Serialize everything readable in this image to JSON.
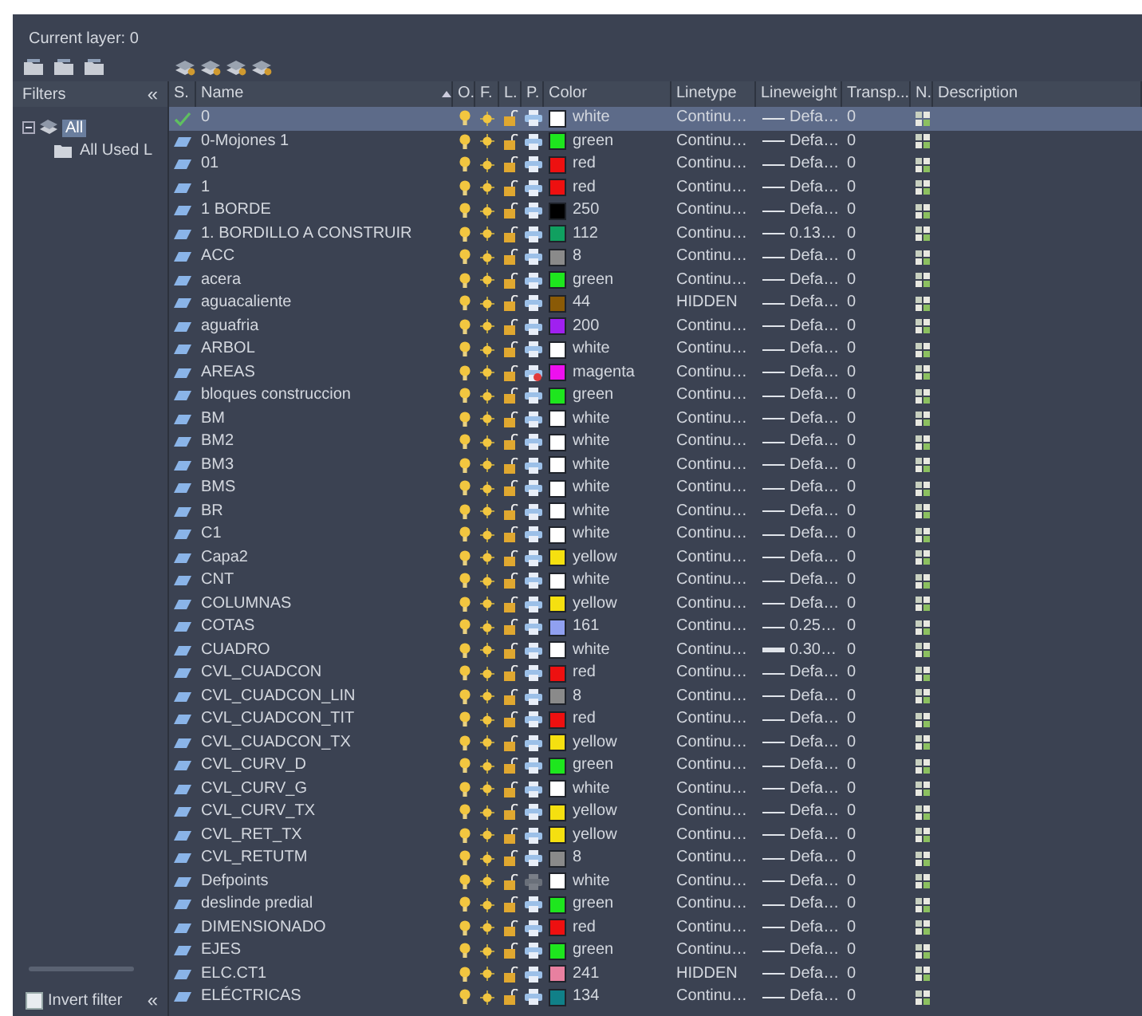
{
  "current_layer": "Current layer: 0",
  "filters": {
    "title": "Filters",
    "collapse": "«",
    "tree": [
      {
        "label": "All",
        "selected": true,
        "expanded": true,
        "children": [
          {
            "label": "All Used L",
            "selected": false
          }
        ]
      }
    ],
    "invert_filter": {
      "label": "Invert filter",
      "checked": false
    },
    "collapse_bottom": "«"
  },
  "columns": [
    "S.",
    "Name",
    "O.",
    "F.",
    "L.",
    "P.",
    "Color",
    "Linetype",
    "Lineweight",
    "Transp...",
    "N.",
    "Description"
  ],
  "rows": [
    {
      "name": "0",
      "current": true,
      "selected": true,
      "color": "#ffffff",
      "color_name": "white",
      "linetype": "Continu…",
      "lineweight": "Defa…",
      "heavy": false,
      "transparency": "0",
      "plot": true,
      "non_plottable": false
    },
    {
      "name": "0-Mojones 1",
      "current": false,
      "selected": false,
      "color": "#1ee61e",
      "color_name": "green",
      "linetype": "Continu…",
      "lineweight": "Defa…",
      "heavy": false,
      "transparency": "0",
      "plot": true,
      "non_plottable": false
    },
    {
      "name": "01",
      "current": false,
      "selected": false,
      "color": "#ee1010",
      "color_name": "red",
      "linetype": "Continu…",
      "lineweight": "Defa…",
      "heavy": false,
      "transparency": "0",
      "plot": true,
      "non_plottable": false
    },
    {
      "name": "1",
      "current": false,
      "selected": false,
      "color": "#ee1010",
      "color_name": "red",
      "linetype": "Continu…",
      "lineweight": "Defa…",
      "heavy": false,
      "transparency": "0",
      "plot": true,
      "non_plottable": false
    },
    {
      "name": "1 BORDE",
      "current": false,
      "selected": false,
      "color": "#000000",
      "color_name": "250",
      "linetype": "Continu…",
      "lineweight": "Defa…",
      "heavy": false,
      "transparency": "0",
      "plot": true,
      "non_plottable": false
    },
    {
      "name": "1. BORDILLO A CONSTRUIR",
      "current": false,
      "selected": false,
      "color": "#10a060",
      "color_name": "112",
      "linetype": "Continu…",
      "lineweight": "0.13…",
      "heavy": false,
      "transparency": "0",
      "plot": true,
      "non_plottable": false
    },
    {
      "name": "ACC",
      "current": false,
      "selected": false,
      "color": "#8a8a8a",
      "color_name": "8",
      "linetype": "Continu…",
      "lineweight": "Defa…",
      "heavy": false,
      "transparency": "0",
      "plot": true,
      "non_plottable": false
    },
    {
      "name": "acera",
      "current": false,
      "selected": false,
      "color": "#1ee61e",
      "color_name": "green",
      "linetype": "Continu…",
      "lineweight": "Defa…",
      "heavy": false,
      "transparency": "0",
      "plot": true,
      "non_plottable": false
    },
    {
      "name": "aguacaliente",
      "current": false,
      "selected": false,
      "color": "#8a5a06",
      "color_name": "44",
      "linetype": "HIDDEN",
      "lineweight": "Defa…",
      "heavy": false,
      "transparency": "0",
      "plot": true,
      "non_plottable": false
    },
    {
      "name": "aguafria",
      "current": false,
      "selected": false,
      "color": "#a020f0",
      "color_name": "200",
      "linetype": "Continu…",
      "lineweight": "Defa…",
      "heavy": false,
      "transparency": "0",
      "plot": true,
      "non_plottable": false
    },
    {
      "name": "ARBOL",
      "current": false,
      "selected": false,
      "color": "#ffffff",
      "color_name": "white",
      "linetype": "Continu…",
      "lineweight": "Defa…",
      "heavy": false,
      "transparency": "0",
      "plot": true,
      "non_plottable": false
    },
    {
      "name": "AREAS",
      "current": false,
      "selected": false,
      "color": "#ee10ee",
      "color_name": "magenta",
      "linetype": "Continu…",
      "lineweight": "Defa…",
      "heavy": false,
      "transparency": "0",
      "plot": false,
      "non_plottable": false
    },
    {
      "name": "bloques  construccion",
      "current": false,
      "selected": false,
      "color": "#1ee61e",
      "color_name": "green",
      "linetype": "Continu…",
      "lineweight": "Defa…",
      "heavy": false,
      "transparency": "0",
      "plot": true,
      "non_plottable": false
    },
    {
      "name": "BM",
      "current": false,
      "selected": false,
      "color": "#ffffff",
      "color_name": "white",
      "linetype": "Continu…",
      "lineweight": "Defa…",
      "heavy": false,
      "transparency": "0",
      "plot": true,
      "non_plottable": false
    },
    {
      "name": "BM2",
      "current": false,
      "selected": false,
      "color": "#ffffff",
      "color_name": "white",
      "linetype": "Continu…",
      "lineweight": "Defa…",
      "heavy": false,
      "transparency": "0",
      "plot": true,
      "non_plottable": false
    },
    {
      "name": "BM3",
      "current": false,
      "selected": false,
      "color": "#ffffff",
      "color_name": "white",
      "linetype": "Continu…",
      "lineweight": "Defa…",
      "heavy": false,
      "transparency": "0",
      "plot": true,
      "non_plottable": false
    },
    {
      "name": "BMS",
      "current": false,
      "selected": false,
      "color": "#ffffff",
      "color_name": "white",
      "linetype": "Continu…",
      "lineweight": "Defa…",
      "heavy": false,
      "transparency": "0",
      "plot": true,
      "non_plottable": false
    },
    {
      "name": "BR",
      "current": false,
      "selected": false,
      "color": "#ffffff",
      "color_name": "white",
      "linetype": "Continu…",
      "lineweight": "Defa…",
      "heavy": false,
      "transparency": "0",
      "plot": true,
      "non_plottable": false
    },
    {
      "name": "C1",
      "current": false,
      "selected": false,
      "color": "#ffffff",
      "color_name": "white",
      "linetype": "Continu…",
      "lineweight": "Defa…",
      "heavy": false,
      "transparency": "0",
      "plot": true,
      "non_plottable": false
    },
    {
      "name": "Capa2",
      "current": false,
      "selected": false,
      "color": "#f5e010",
      "color_name": "yellow",
      "linetype": "Continu…",
      "lineweight": "Defa…",
      "heavy": false,
      "transparency": "0",
      "plot": true,
      "non_plottable": false
    },
    {
      "name": "CNT",
      "current": false,
      "selected": false,
      "color": "#ffffff",
      "color_name": "white",
      "linetype": "Continu…",
      "lineweight": "Defa…",
      "heavy": false,
      "transparency": "0",
      "plot": true,
      "non_plottable": false
    },
    {
      "name": "COLUMNAS",
      "current": false,
      "selected": false,
      "color": "#f5e010",
      "color_name": "yellow",
      "linetype": "Continu…",
      "lineweight": "Defa…",
      "heavy": false,
      "transparency": "0",
      "plot": true,
      "non_plottable": false
    },
    {
      "name": "COTAS",
      "current": false,
      "selected": false,
      "color": "#90a0f0",
      "color_name": "161",
      "linetype": "Continu…",
      "lineweight": "0.25…",
      "heavy": false,
      "transparency": "0",
      "plot": true,
      "non_plottable": false
    },
    {
      "name": "CUADRO",
      "current": false,
      "selected": false,
      "color": "#ffffff",
      "color_name": "white",
      "linetype": "Continu…",
      "lineweight": "0.30…",
      "heavy": true,
      "transparency": "0",
      "plot": true,
      "non_plottable": false
    },
    {
      "name": "CVL_CUADCON",
      "current": false,
      "selected": false,
      "color": "#ee1010",
      "color_name": "red",
      "linetype": "Continu…",
      "lineweight": "Defa…",
      "heavy": false,
      "transparency": "0",
      "plot": true,
      "non_plottable": false
    },
    {
      "name": "CVL_CUADCON_LIN",
      "current": false,
      "selected": false,
      "color": "#8a8a8a",
      "color_name": "8",
      "linetype": "Continu…",
      "lineweight": "Defa…",
      "heavy": false,
      "transparency": "0",
      "plot": true,
      "non_plottable": false
    },
    {
      "name": "CVL_CUADCON_TIT",
      "current": false,
      "selected": false,
      "color": "#ee1010",
      "color_name": "red",
      "linetype": "Continu…",
      "lineweight": "Defa…",
      "heavy": false,
      "transparency": "0",
      "plot": true,
      "non_plottable": false
    },
    {
      "name": "CVL_CUADCON_TX",
      "current": false,
      "selected": false,
      "color": "#f5e010",
      "color_name": "yellow",
      "linetype": "Continu…",
      "lineweight": "Defa…",
      "heavy": false,
      "transparency": "0",
      "plot": true,
      "non_plottable": false
    },
    {
      "name": "CVL_CURV_D",
      "current": false,
      "selected": false,
      "color": "#1ee61e",
      "color_name": "green",
      "linetype": "Continu…",
      "lineweight": "Defa…",
      "heavy": false,
      "transparency": "0",
      "plot": true,
      "non_plottable": false
    },
    {
      "name": "CVL_CURV_G",
      "current": false,
      "selected": false,
      "color": "#ffffff",
      "color_name": "white",
      "linetype": "Continu…",
      "lineweight": "Defa…",
      "heavy": false,
      "transparency": "0",
      "plot": true,
      "non_plottable": false
    },
    {
      "name": "CVL_CURV_TX",
      "current": false,
      "selected": false,
      "color": "#f5e010",
      "color_name": "yellow",
      "linetype": "Continu…",
      "lineweight": "Defa…",
      "heavy": false,
      "transparency": "0",
      "plot": true,
      "non_plottable": false
    },
    {
      "name": "CVL_RET_TX",
      "current": false,
      "selected": false,
      "color": "#f5e010",
      "color_name": "yellow",
      "linetype": "Continu…",
      "lineweight": "Defa…",
      "heavy": false,
      "transparency": "0",
      "plot": true,
      "non_plottable": false
    },
    {
      "name": "CVL_RETUTM",
      "current": false,
      "selected": false,
      "color": "#8a8a8a",
      "color_name": "8",
      "linetype": "Continu…",
      "lineweight": "Defa…",
      "heavy": false,
      "transparency": "0",
      "plot": true,
      "non_plottable": false
    },
    {
      "name": "Defpoints",
      "current": false,
      "selected": false,
      "color": "#ffffff",
      "color_name": "white",
      "linetype": "Continu…",
      "lineweight": "Defa…",
      "heavy": false,
      "transparency": "0",
      "plot": true,
      "non_plottable": true
    },
    {
      "name": "deslinde predial",
      "current": false,
      "selected": false,
      "color": "#1ee61e",
      "color_name": "green",
      "linetype": "Continu…",
      "lineweight": "Defa…",
      "heavy": false,
      "transparency": "0",
      "plot": true,
      "non_plottable": false
    },
    {
      "name": "DIMENSIONADO",
      "current": false,
      "selected": false,
      "color": "#ee1010",
      "color_name": "red",
      "linetype": "Continu…",
      "lineweight": "Defa…",
      "heavy": false,
      "transparency": "0",
      "plot": true,
      "non_plottable": false
    },
    {
      "name": "EJES",
      "current": false,
      "selected": false,
      "color": "#1ee61e",
      "color_name": "green",
      "linetype": "Continu…",
      "lineweight": "Defa…",
      "heavy": false,
      "transparency": "0",
      "plot": true,
      "non_plottable": false
    },
    {
      "name": "ELC.CT1",
      "current": false,
      "selected": false,
      "color": "#e880a0",
      "color_name": "241",
      "linetype": "HIDDEN",
      "lineweight": "Defa…",
      "heavy": false,
      "transparency": "0",
      "plot": true,
      "non_plottable": false
    },
    {
      "name": "ELÉCTRICAS",
      "current": false,
      "selected": false,
      "color": "#108088",
      "color_name": "134",
      "linetype": "Continu…",
      "lineweight": "Defa…",
      "heavy": false,
      "transparency": "0",
      "plot": true,
      "non_plottable": false
    }
  ]
}
